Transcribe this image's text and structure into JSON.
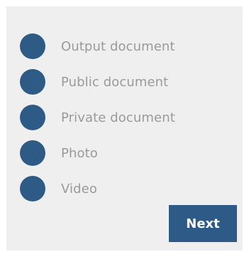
{
  "options": [
    {
      "label": "Output document"
    },
    {
      "label": "Public document"
    },
    {
      "label": "Private document"
    },
    {
      "label": "Photo"
    },
    {
      "label": "Video"
    }
  ],
  "next_button": {
    "label": "Next"
  },
  "colors": {
    "radio": "#2e5a86",
    "button": "#2d5a86",
    "label": "#9a9a9a",
    "panel": "#efefef"
  }
}
